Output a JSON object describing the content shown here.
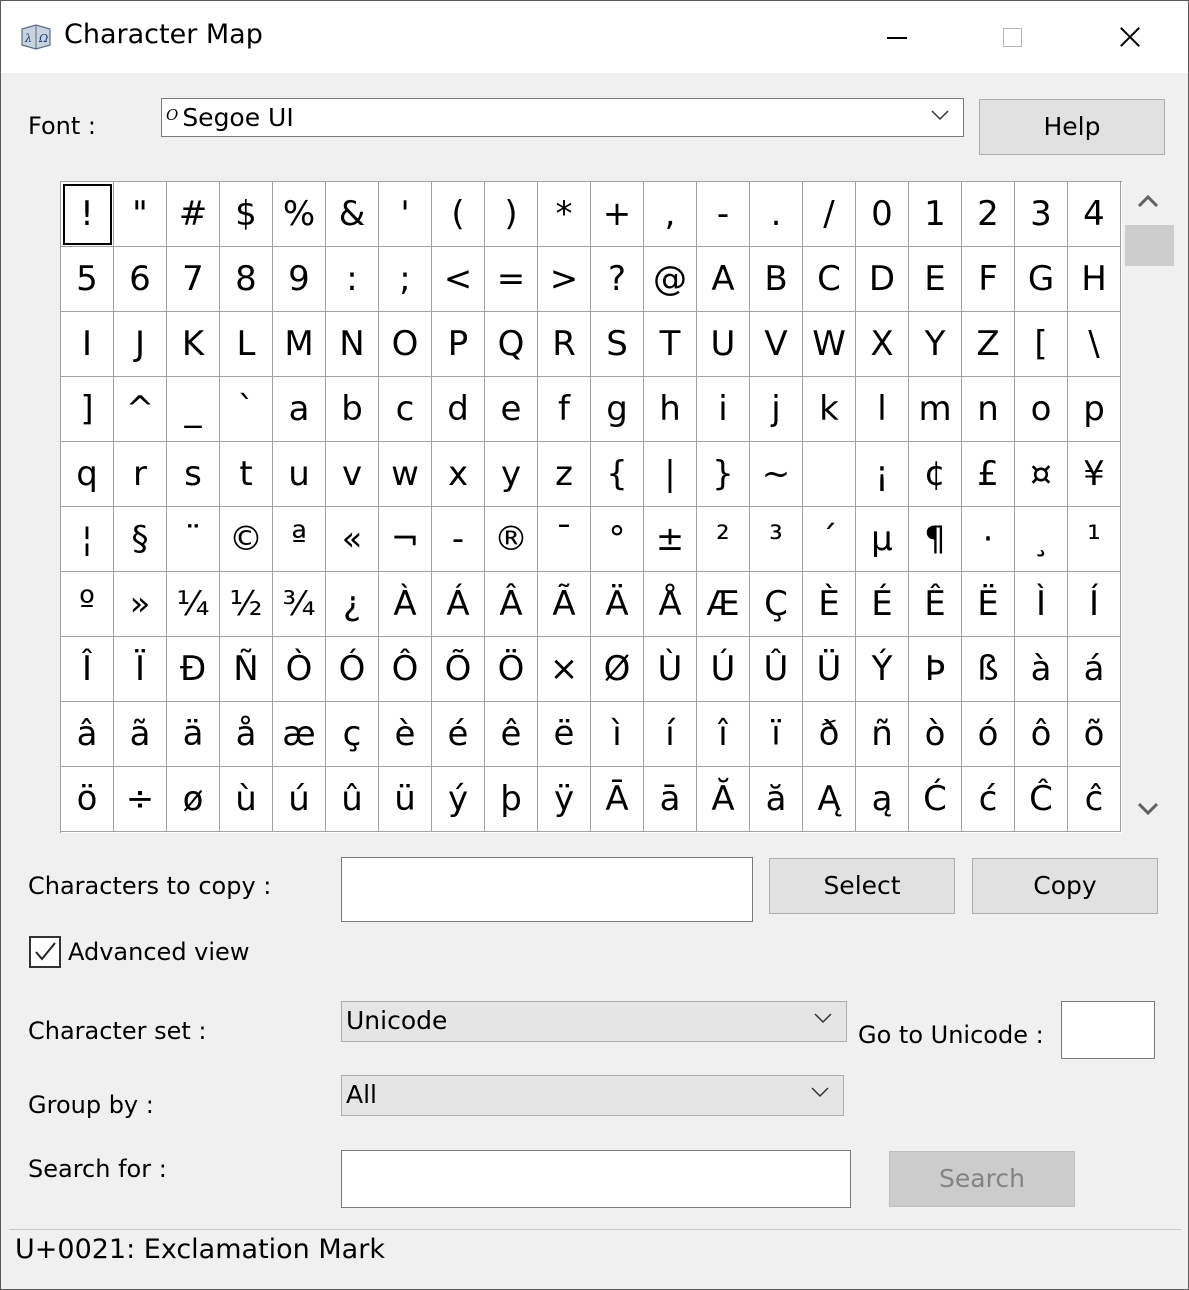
{
  "window": {
    "title": "Character Map"
  },
  "font": {
    "label": "Font :",
    "value": "Segoe UI",
    "font_glyph": "O",
    "help_label": "Help"
  },
  "chars": [
    "!",
    "\"",
    "#",
    "$",
    "%",
    "&",
    "'",
    "(",
    ")",
    "*",
    "+",
    ",",
    "-",
    ".",
    "/",
    "0",
    "1",
    "2",
    "3",
    "4",
    "5",
    "6",
    "7",
    "8",
    "9",
    ":",
    ";",
    "<",
    "=",
    ">",
    "?",
    "@",
    "A",
    "B",
    "C",
    "D",
    "E",
    "F",
    "G",
    "H",
    "I",
    "J",
    "K",
    "L",
    "M",
    "N",
    "O",
    "P",
    "Q",
    "R",
    "S",
    "T",
    "U",
    "V",
    "W",
    "X",
    "Y",
    "Z",
    "[",
    "\\",
    "]",
    "^",
    "_",
    "`",
    "a",
    "b",
    "c",
    "d",
    "e",
    "f",
    "g",
    "h",
    "i",
    "j",
    "k",
    "l",
    "m",
    "n",
    "o",
    "p",
    "q",
    "r",
    "s",
    "t",
    "u",
    "v",
    "w",
    "x",
    "y",
    "z",
    "{",
    "|",
    "}",
    "~",
    "",
    "¡",
    "¢",
    "£",
    "¤",
    "¥",
    "¦",
    "§",
    "¨",
    "©",
    "ª",
    "«",
    "¬",
    "-",
    "®",
    "¯",
    "°",
    "±",
    "²",
    "³",
    "´",
    "µ",
    "¶",
    "·",
    "¸",
    "¹",
    "º",
    "»",
    "¼",
    "½",
    "¾",
    "¿",
    "À",
    "Á",
    "Â",
    "Ã",
    "Ä",
    "Å",
    "Æ",
    "Ç",
    "È",
    "É",
    "Ê",
    "Ë",
    "Ì",
    "Í",
    "Î",
    "Ï",
    "Ð",
    "Ñ",
    "Ò",
    "Ó",
    "Ô",
    "Õ",
    "Ö",
    "×",
    "Ø",
    "Ù",
    "Ú",
    "Û",
    "Ü",
    "Ý",
    "Þ",
    "ß",
    "à",
    "á",
    "â",
    "ã",
    "ä",
    "å",
    "æ",
    "ç",
    "è",
    "é",
    "ê",
    "ë",
    "ì",
    "í",
    "î",
    "ï",
    "ð",
    "ñ",
    "ò",
    "ó",
    "ô",
    "õ",
    "ö",
    "÷",
    "ø",
    "ù",
    "ú",
    "û",
    "ü",
    "ý",
    "þ",
    "ÿ",
    "Ā",
    "ā",
    "Ă",
    "ă",
    "Ą",
    "ą",
    "Ć",
    "ć",
    "Ĉ",
    "ĉ"
  ],
  "copy": {
    "label": "Characters to copy :",
    "value": "",
    "select_label": "Select",
    "copy_label": "Copy"
  },
  "advanced": {
    "label": "Advanced view",
    "checked": true
  },
  "charset": {
    "label": "Character set :",
    "value": "Unicode"
  },
  "goto": {
    "label": "Go to Unicode :",
    "value": ""
  },
  "group": {
    "label": "Group by :",
    "value": "All"
  },
  "search": {
    "label": "Search for :",
    "value": "",
    "button_label": "Search"
  },
  "status": {
    "text": "U+0021: Exclamation Mark"
  }
}
